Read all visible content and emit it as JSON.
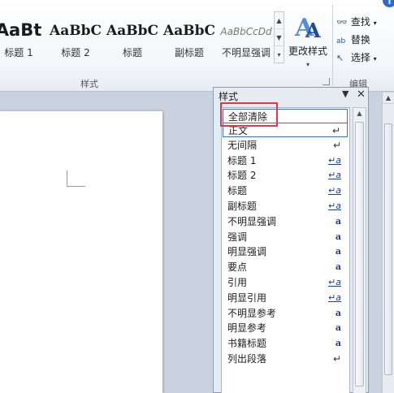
{
  "ribbon": {
    "quick_styles": [
      {
        "sample": "AaBt",
        "name": "标题 1",
        "variant": "big"
      },
      {
        "sample": "AaBbC",
        "name": "标题 2",
        "variant": "serif"
      },
      {
        "sample": "AaBbC",
        "name": "标题",
        "variant": "serif"
      },
      {
        "sample": "AaBbC",
        "name": "副标题",
        "variant": "serif"
      },
      {
        "sample": "AaBbCcDd",
        "name": "不明显强调",
        "variant": "light"
      }
    ],
    "change_styles_label": "更改样式",
    "styles_group_label": "样式",
    "editing": {
      "find_label": "查找",
      "replace_label": "替换",
      "select_label": "选择",
      "group_label": "编辑"
    }
  },
  "styles_pane": {
    "title": "样式",
    "clear_all_label": "全部清除",
    "items": [
      {
        "label": "正文",
        "mark": "↵",
        "type": "paragraph",
        "active": true
      },
      {
        "label": "无间隔",
        "mark": "↵",
        "type": "paragraph"
      },
      {
        "label": "标题 1",
        "mark": "↵a",
        "type": "linked"
      },
      {
        "label": "标题 2",
        "mark": "↵a",
        "type": "linked"
      },
      {
        "label": "标题",
        "mark": "↵a",
        "type": "linked"
      },
      {
        "label": "副标题",
        "mark": "↵a",
        "type": "linked"
      },
      {
        "label": "不明显强调",
        "mark": "a",
        "type": "character"
      },
      {
        "label": "强调",
        "mark": "a",
        "type": "character"
      },
      {
        "label": "明显强调",
        "mark": "a",
        "type": "character"
      },
      {
        "label": "要点",
        "mark": "a",
        "type": "character"
      },
      {
        "label": "引用",
        "mark": "↵a",
        "type": "linked"
      },
      {
        "label": "明显引用",
        "mark": "↵a",
        "type": "linked"
      },
      {
        "label": "不明显参考",
        "mark": "a",
        "type": "character"
      },
      {
        "label": "明显参考",
        "mark": "a",
        "type": "character"
      },
      {
        "label": "书籍标题",
        "mark": "a",
        "type": "character"
      },
      {
        "label": "列出段落",
        "mark": "↵",
        "type": "paragraph"
      }
    ]
  },
  "colors": {
    "highlight": "#e0354a",
    "selection": "#3d6fb5",
    "style_mark": "#1f3f8a"
  }
}
